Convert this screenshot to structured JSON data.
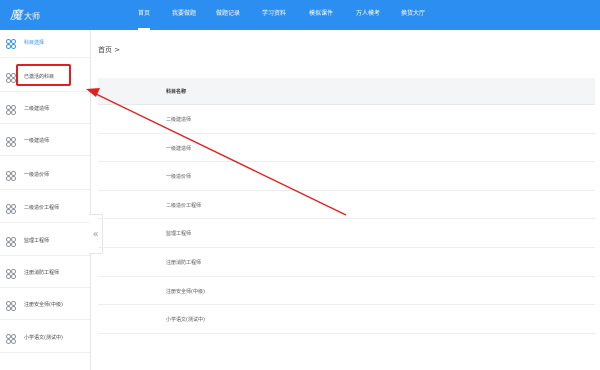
{
  "logo": {
    "text_a": "魔",
    "text_b": "大师"
  },
  "nav": [
    {
      "label": "首页",
      "active": true
    },
    {
      "label": "我要做题"
    },
    {
      "label": "做题记录"
    },
    {
      "label": "学习资料"
    },
    {
      "label": "模拟课件"
    },
    {
      "label": "万人模考"
    },
    {
      "label": "换货大厅"
    }
  ],
  "sidebar": {
    "items": [
      {
        "label": "科目选择",
        "active": true
      },
      {
        "label": "已激活的科目"
      },
      {
        "label": "二级建造师"
      },
      {
        "label": "一级建造师"
      },
      {
        "label": "一级造价师"
      },
      {
        "label": "二级造价工程师"
      },
      {
        "label": "监理工程师"
      },
      {
        "label": "注册消防工程师"
      },
      {
        "label": "注册安全师(中级)"
      },
      {
        "label": "小学语文(测试中)"
      }
    ],
    "collapse_icon": "«"
  },
  "breadcrumb": "首页 >",
  "table": {
    "header": "科目名称",
    "rows": [
      "二级建造师",
      "一级建造师",
      "一级造价师",
      "二级造价工程师",
      "监理工程师",
      "注册消防工程师",
      "注册安全师(中级)",
      "小学语文(测试中)"
    ]
  },
  "colors": {
    "primary": "#2d8ef1",
    "annotation": "#e02020"
  }
}
